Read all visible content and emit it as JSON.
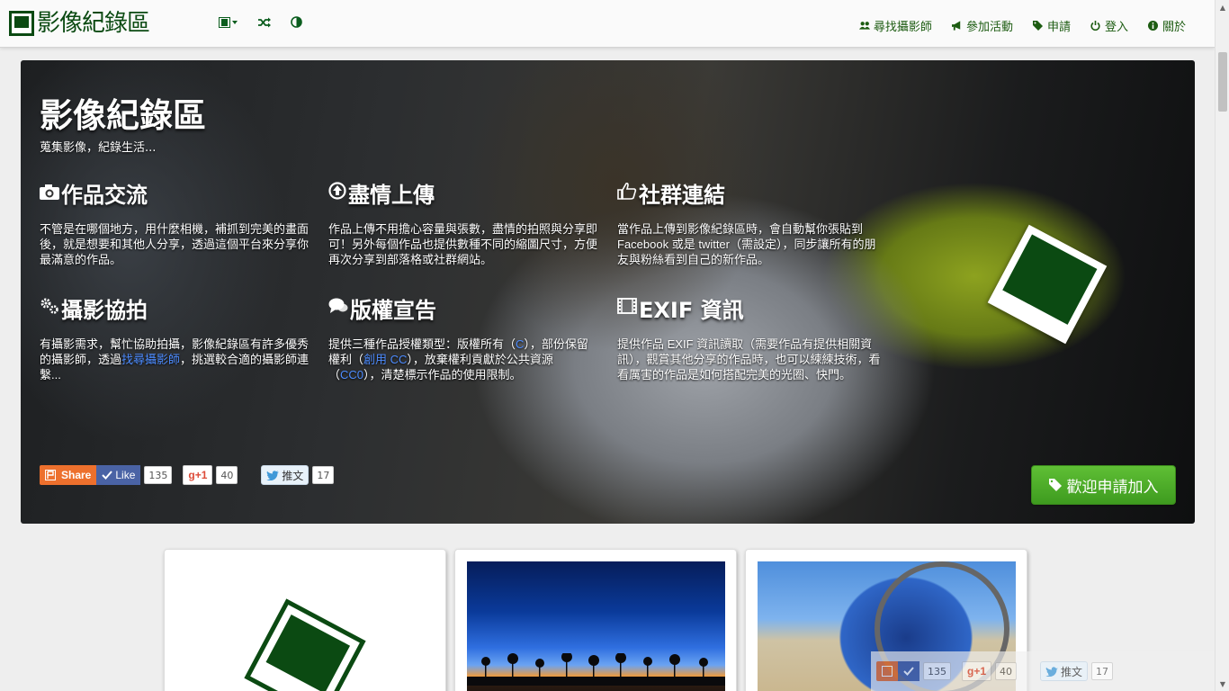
{
  "brand": {
    "title": "影像紀錄區"
  },
  "nav": {
    "tools": [
      {
        "name": "film-menu",
        "icon": "film-icon"
      },
      {
        "name": "random",
        "icon": "shuffle-icon"
      },
      {
        "name": "contrast",
        "icon": "contrast-icon"
      }
    ],
    "links": [
      {
        "label": "尋找攝影師",
        "icon": "users-icon"
      },
      {
        "label": "參加活動",
        "icon": "bullhorn-icon"
      },
      {
        "label": "申請",
        "icon": "tag-icon"
      },
      {
        "label": "登入",
        "icon": "power-icon"
      },
      {
        "label": "關於",
        "icon": "info-icon"
      }
    ]
  },
  "hero": {
    "title": "影像紀錄區",
    "subtitle": "蒐集影像，紀錄生活...",
    "features": [
      {
        "title": "作品交流",
        "icon": "camera-icon",
        "text": "不管是在哪個地方，用什麼相機，補抓到完美的畫面後，就是想要和其他人分享，透過這個平台來分享你最滿意的作品。"
      },
      {
        "title": "盡情上傳",
        "icon": "upload-icon",
        "text": "作品上傳不用擔心容量與張數，盡情的拍照與分享即可！另外每個作品也提供數種不同的縮圖尺寸，方便再次分享到部落格或社群網站。"
      },
      {
        "title": "社群連結",
        "icon": "thumbs-up-icon",
        "text": "當作品上傳到影像紀錄區時，會自動幫你張貼到 Facebook 或是 twitter（需設定），同步讓所有的朋友與粉絲看到自己的新作品。"
      },
      {
        "title": "攝影協拍",
        "icon": "cogs-icon",
        "text_before": "有攝影需求，幫忙協助拍攝，影像紀錄區有許多優秀的攝影師，透過",
        "link": "找尋攝影師",
        "text_after": "，挑選較合適的攝影師連繫..."
      },
      {
        "title": "版權宣告",
        "icon": "comments-icon",
        "t1": "提供三種作品授權類型：版權所有（",
        "l1": "C",
        "t2": "），部份保留權利（",
        "l2": "創用 CC",
        "t3": "），放棄權利貢獻於公共資源（",
        "l3": "CC0",
        "t4": "），清楚標示作品的使用限制。"
      },
      {
        "title": "EXIF 資訊",
        "icon": "film-icon",
        "text": "提供作品 EXIF 資訊讀取（需要作品有提供相關資訊），觀賞其他分享的作品時，也可以練練技術，看看厲害的作品是如何搭配完美的光圈、快門。"
      }
    ],
    "share": {
      "share_label": "Share",
      "like_label": "Like",
      "like_count": "135",
      "gplus_label": "g+1",
      "gplus_count": "40",
      "tweet_label": "推文",
      "tweet_count": "17"
    },
    "join_label": "歡迎申請加入"
  },
  "floating_share": {
    "like_count": "135",
    "gplus_label": "g+1",
    "gplus_count": "40",
    "tweet_label": "推文",
    "tweet_count": "17"
  },
  "colors": {
    "brand_green": "#0b4a12",
    "join_green": "#4cae2a",
    "link_blue": "#4d8cff"
  }
}
